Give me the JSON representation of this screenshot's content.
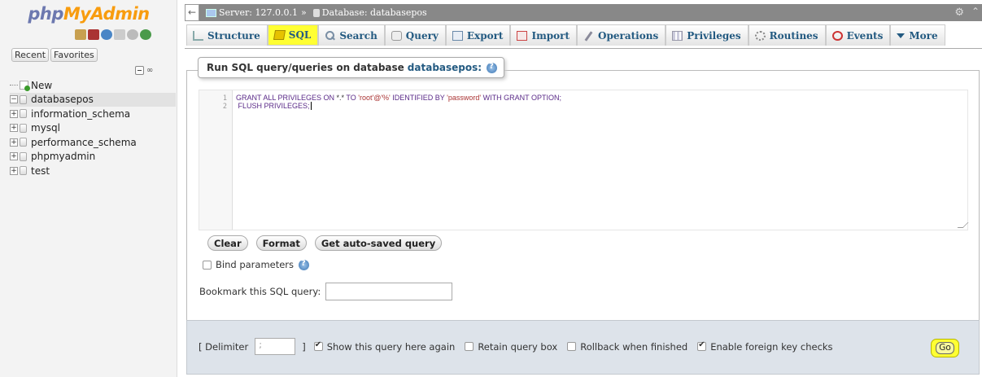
{
  "nav": {
    "logo_part1": "php",
    "logo_part2": "MyAdmin",
    "recent_tab": "Recent",
    "favorites_tab": "Favorites",
    "tree": [
      {
        "label": "New",
        "kind": "new"
      },
      {
        "label": "databasepos",
        "kind": "db",
        "selected": true
      },
      {
        "label": "information_schema",
        "kind": "db"
      },
      {
        "label": "mysql",
        "kind": "db"
      },
      {
        "label": "performance_schema",
        "kind": "db"
      },
      {
        "label": "phpmyadmin",
        "kind": "db"
      },
      {
        "label": "test",
        "kind": "db"
      }
    ]
  },
  "breadcrumb": {
    "server": "Server: 127.0.0.1",
    "separator": "»",
    "database": "Database: databasepos"
  },
  "tabs": [
    {
      "label": "Structure",
      "icon": "structure-icon"
    },
    {
      "label": "SQL",
      "icon": "sql-icon",
      "active": true
    },
    {
      "label": "Search",
      "icon": "search-icon"
    },
    {
      "label": "Query",
      "icon": "query-icon"
    },
    {
      "label": "Export",
      "icon": "export-icon"
    },
    {
      "label": "Import",
      "icon": "import-icon"
    },
    {
      "label": "Operations",
      "icon": "operations-icon"
    },
    {
      "label": "Privileges",
      "icon": "privileges-icon"
    },
    {
      "label": "Routines",
      "icon": "routines-icon"
    },
    {
      "label": "Events",
      "icon": "events-icon"
    },
    {
      "label": "More",
      "icon": "more-chevron-icon"
    }
  ],
  "sql_panel": {
    "legend_text": "Run SQL query/queries on database",
    "legend_db": "databasepos:",
    "line_numbers": [
      "1",
      "2"
    ],
    "line1_a": "GRANT ALL PRIVILEGES ON ",
    "line1_b": "*.*",
    "line1_c": " TO ",
    "line1_d": "'root'@'%'",
    "line1_e": " IDENTIFIED BY ",
    "line1_f": "'password'",
    "line1_g": " WITH GRANT OPTION;",
    "line2": " FLUSH PRIVILEGES;",
    "clear_button": "Clear",
    "format_button": "Format",
    "autosave_button": "Get auto-saved query",
    "bind_parameters": "Bind parameters",
    "bookmark_label": "Bookmark this SQL query:",
    "bookmark_value": ""
  },
  "options": {
    "delimiter_label": "[ Delimiter",
    "delimiter_value": ";",
    "delimiter_close": "]",
    "show_query_again": "Show this query here again",
    "retain_query_box": "Retain query box",
    "rollback_when_finished": "Rollback when finished",
    "enable_fk_checks": "Enable foreign key checks",
    "go_button": "Go"
  },
  "colors": {
    "highlight": "#ffff33",
    "link": "#235a81",
    "topbar": "#888888"
  }
}
